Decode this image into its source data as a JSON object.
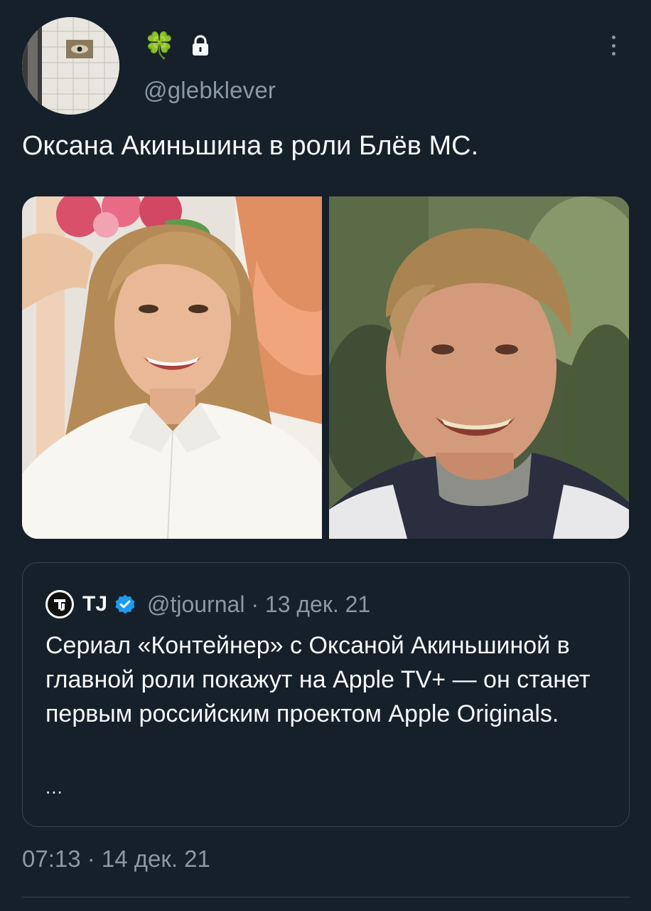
{
  "author": {
    "display_name_emoji": "🍀",
    "handle": "@glebklever",
    "protected": true
  },
  "tweet": {
    "text": "Оксана Акиньшина в роли Блёв МС.",
    "timestamp": "07:13 · 14 дек. 21"
  },
  "media": [
    {
      "name": "photo-woman-smiling"
    },
    {
      "name": "photo-young-man-smiling"
    }
  ],
  "quoted_tweet": {
    "author_name": "TJ",
    "verified": true,
    "meta": "@tjournal · 13 дек. 21",
    "text": "Сериал «Контейнер» с Оксаной Акиньшиной в главной роли покажут на Apple TV+ — он станет первым российским проектом Apple Originals.",
    "ellipsis": "..."
  },
  "colors": {
    "background": "#15202b",
    "text": "#f7f9f9",
    "secondary": "#8b98a5",
    "border": "#38444d",
    "verified": "#1d9bf0"
  },
  "icons": [
    "clover-emoji",
    "lock-icon",
    "more-icon",
    "verified-icon"
  ]
}
